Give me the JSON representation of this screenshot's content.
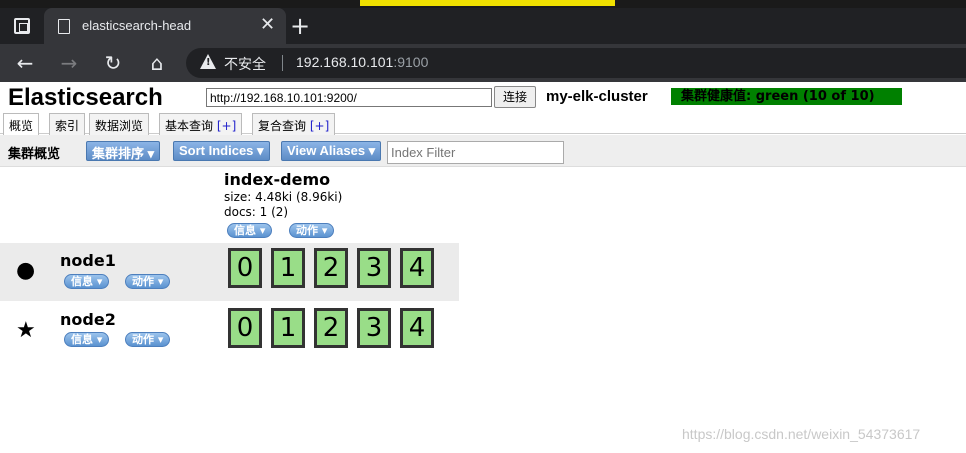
{
  "browser": {
    "tab_title": "elasticsearch-head",
    "close_glyph": "✕",
    "newtab_glyph": "+",
    "security_text": "不安全",
    "url_host": "192.168.10.101",
    "url_port": ":9100"
  },
  "header": {
    "title": "Elasticsearch",
    "connect_url": "http://192.168.10.101:9200/",
    "connect_label": "连接",
    "cluster_name": "my-elk-cluster",
    "health_text": "集群健康值: green (10 of 10)",
    "health_color": "#008000"
  },
  "tabs": [
    {
      "label": "概览"
    },
    {
      "label": "索引"
    },
    {
      "label": "数据浏览"
    },
    {
      "label": "基本查询",
      "plus": "[+]"
    },
    {
      "label": "复合查询",
      "plus": "[+]"
    }
  ],
  "controls": {
    "label": "集群概览",
    "sort_cluster": "集群排序 ▾",
    "sort_indices": "Sort Indices ▾",
    "view_aliases": "View Aliases ▾",
    "filter_placeholder": "Index Filter"
  },
  "index": {
    "name": "index-demo",
    "size": "size: 4.48ki (8.96ki)",
    "docs": "docs: 1 (2)",
    "info_btn": "信息 ▾",
    "action_btn": "动作 ▾"
  },
  "nodes": [
    {
      "name": "node1",
      "icon": "●",
      "info_btn": "信息 ▾",
      "action_btn": "动作 ▾",
      "shards": [
        "0",
        "1",
        "2",
        "3",
        "4"
      ]
    },
    {
      "name": "node2",
      "icon": "★",
      "info_btn": "信息 ▾",
      "action_btn": "动作 ▾",
      "shards": [
        "0",
        "1",
        "2",
        "3",
        "4"
      ]
    }
  ],
  "colors": {
    "shard_bg": "#99dd88",
    "accent_blue": "#5d8cc6"
  },
  "watermark": "https://blog.csdn.net/weixin_54373617"
}
